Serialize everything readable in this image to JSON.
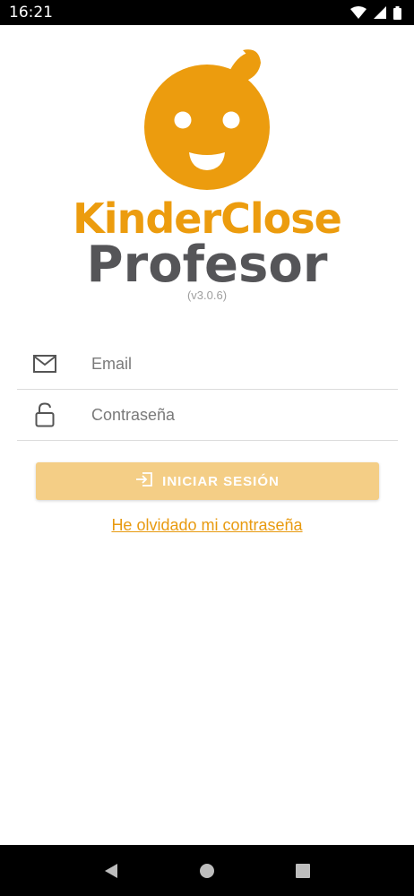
{
  "status_bar": {
    "time": "16:21",
    "icons": [
      "wifi-icon",
      "signal-icon",
      "battery-icon"
    ]
  },
  "logo": {
    "icon": "child-face-logo-icon",
    "brand_name": "KinderClose",
    "product_name": "Profesor",
    "version": "(v3.0.6)",
    "colors": {
      "orange": "#EC9C0E",
      "gray": "#555558"
    }
  },
  "form": {
    "email": {
      "icon": "envelope-icon",
      "placeholder": "Email",
      "value": ""
    },
    "password": {
      "icon": "unlock-icon",
      "placeholder": "Contraseña",
      "value": ""
    },
    "login_button": {
      "icon": "login-icon",
      "label": "INICIAR SESIÓN",
      "color": "#F4CE86"
    },
    "forgot_link": "He olvidado mi contraseña"
  },
  "nav_bar": {
    "buttons": [
      "back-icon",
      "home-icon",
      "recents-icon"
    ]
  }
}
